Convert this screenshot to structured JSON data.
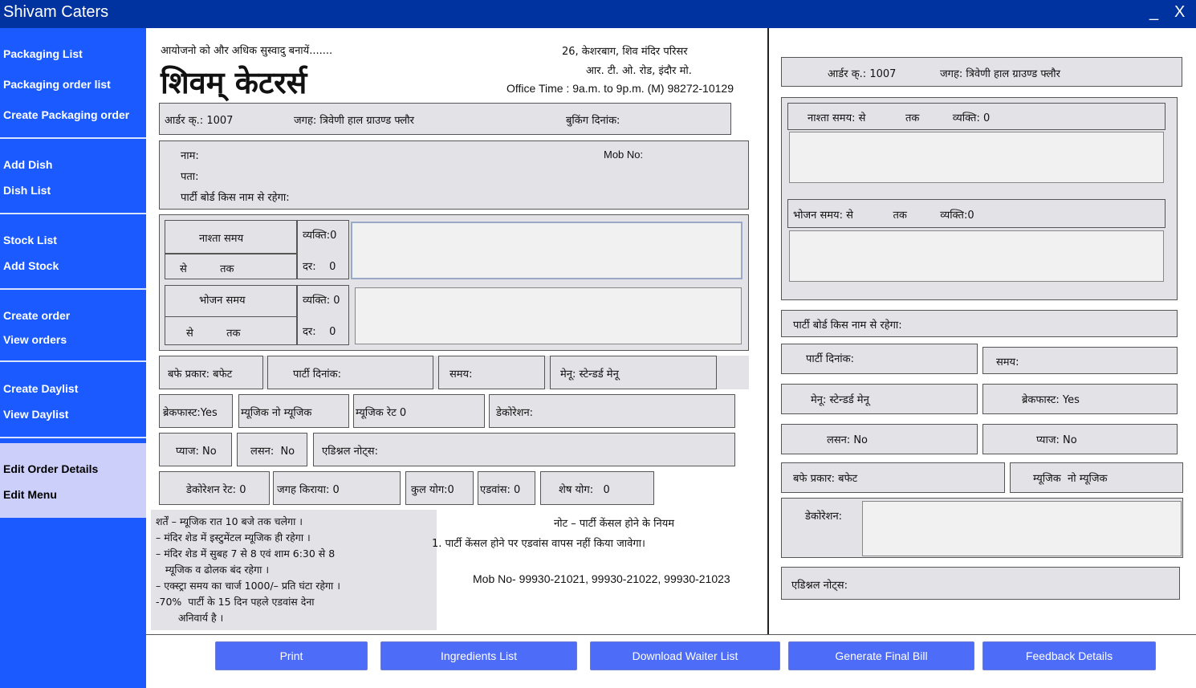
{
  "window": {
    "title": "Shivam Caters",
    "minimize": "_",
    "close": "X"
  },
  "sidebar": {
    "groups": [
      {
        "items": [
          "Packaging List",
          "Packaging order list",
          "Create Packaging order"
        ]
      },
      {
        "items": [
          "Add Dish",
          "Dish List"
        ]
      },
      {
        "items": [
          "Stock List",
          "Add Stock"
        ]
      },
      {
        "items": [
          "Create order",
          "View orders"
        ]
      },
      {
        "items": [
          "Create Daylist",
          "View Daylist"
        ]
      },
      {
        "items": [
          "Edit Order Details",
          "Edit Menu"
        ]
      }
    ]
  },
  "colors": {
    "titlebar": "#0033a0",
    "sidebar": "#1a5aff",
    "sidebar_active": "#cccff9",
    "button": "#4d6cf8",
    "panel": "#e3e3e7"
  },
  "header": {
    "tagline": "आयोजनो को और अधिक सुस्वादु बनायें.......",
    "brand": "शिवम् केटरर्स",
    "address1": "26, केशरबाग, शिव मंदिर परिसर",
    "address2": "आर. टी. ओ. रोड, इंदौर मो.",
    "office_time": "Office Time : 9a.m. to 9p.m. (M) 98272-10129"
  },
  "order": {
    "order_no": "आर्डर क्.: 1007",
    "place": "जगह: त्रिवेणी हाल ग्राउण्ड फ्लौर",
    "booking_date": "बुकिंग दिनांक:"
  },
  "customer": {
    "name": "नाम:",
    "mob": "Mob No:",
    "address": "पता:",
    "party_board": "पार्टी बोर्ड किस नाम से रहेगा:"
  },
  "meals": {
    "breakfast": {
      "label": "नाश्ता समय",
      "from_to": "से          तक",
      "persons": "व्यक्ति:0",
      "rate": "दर:    0"
    },
    "lunch": {
      "label": "भोजन समय",
      "from_to": "से          तक",
      "persons": "व्यक्ति: 0",
      "rate": "दर:    0"
    }
  },
  "row1": {
    "buffet": "बफे प्रकार: बफेट",
    "party_date": "पार्टी दिनांक:",
    "time": "समय:",
    "menu": "मेनू: स्टेन्डर्ड मेनू"
  },
  "row2": {
    "breakfast": "ब्रेकफास्ट:Yes",
    "music": "म्यूजिक नो म्यूजिक",
    "music_rate": "म्यूजिक रेट 0",
    "decoration": "डेकोरेशन:"
  },
  "row3": {
    "onion": "प्याज: No",
    "garlic": "लसन:  No",
    "notes": "एडिश्नल नोट्स:"
  },
  "row4": {
    "deco_rate": "डेकोरेशन रेट: 0",
    "place_rent": "जगह किराया: 0",
    "total": "कुल योग:0",
    "advance": "एडवांस: 0",
    "balance": "शेष योग:   0"
  },
  "terms": [
    "शर्तें – म्यूजिक रात 10 बजे तक चलेगा ।",
    "– मंदिर शेड में इस्टुमेंटल म्यूजिक ही रहेगा ।",
    "– मंदिर शेड में सुबह 7 से 8 एवं शाम 6:30 से 8",
    "   म्यूजिक व ढोलक बंद रहेगा ।",
    "– एक्स्ट्रा समय का चार्ज 1000/– प्रति घंटा रहेगा ।",
    "-70%  पार्टी के 15 दिन पहले एडवांस देना",
    "       अनिवार्य है ।"
  ],
  "note": {
    "title": "नोट – पार्टी केंसल होने के नियम",
    "line1": "1. पार्टी केंसल होने पर एडवांस वापस नहीं किया जावेगा।",
    "mobiles": "Mob No- 99930-21021, 99930-21022, 99930-21023"
  },
  "right": {
    "order_no": "आर्डर क्.: 1007",
    "place": "जगह: त्रिवेणी हाल ग्राउण्ड फ्लौर",
    "breakfast_line": "नाश्ता समय: से            तक          व्यक्ति: 0",
    "lunch_line": "भोजन समय: से            तक          व्यक्ति:0",
    "party_board": "पार्टी बोर्ड किस नाम से रहेगा:",
    "party_date": "पार्टी दिनांक:",
    "time": "समय:",
    "menu": "मेनू: स्टेन्डर्ड मेनू",
    "breakfast": "ब्रेकफास्ट: Yes",
    "garlic": "लसन: No",
    "onion": "प्याज: No",
    "buffet": "बफे प्रकार: बफेट",
    "music": "म्यूजिक  नो म्यूजिक",
    "decoration": "डेकोरेशन:",
    "notes": "एडिश्नल नोट्स:"
  },
  "buttons": [
    "Print",
    "Ingredients List",
    "Download Waiter List",
    "Generate Final Bill",
    "Feedback Details"
  ]
}
